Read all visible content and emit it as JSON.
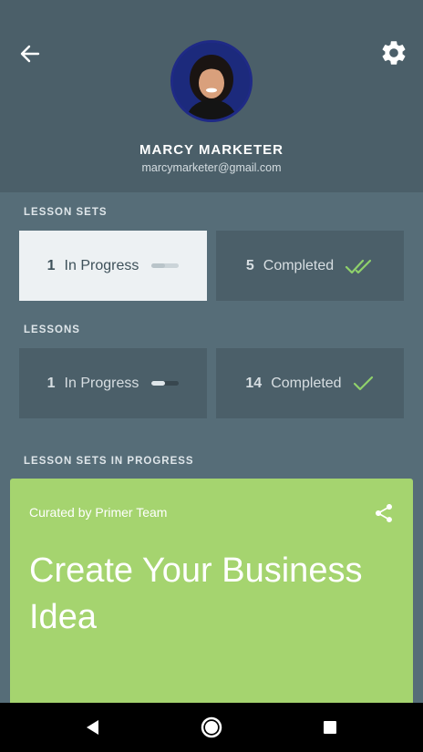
{
  "profile": {
    "name": "MARCY MARKETER",
    "email": "marcymarketer@gmail.com"
  },
  "icons": {
    "back": "arrow-left-icon",
    "settings": "gear-icon",
    "share": "share-icon",
    "completed_sets": "double-check-icon",
    "completed_lessons": "check-icon",
    "nav_back": "triangle-back-icon",
    "nav_home": "circle-home-icon",
    "nav_recents": "square-recents-icon"
  },
  "lesson_sets": {
    "label": "LESSON SETS",
    "in_progress": {
      "count": "1",
      "label": "In Progress",
      "progress": 0.5
    },
    "completed": {
      "count": "5",
      "label": "Completed"
    }
  },
  "lessons": {
    "label": "LESSONS",
    "in_progress": {
      "count": "1",
      "label": "In Progress",
      "progress": 0.5
    },
    "completed": {
      "count": "14",
      "label": "Completed"
    }
  },
  "in_progress_section": {
    "label": "LESSON SETS IN PROGRESS",
    "card": {
      "curator": "Curated by Primer Team",
      "title": "Create Your Business Idea"
    }
  },
  "colors": {
    "header_bg": "#4b5f69",
    "body_bg": "#566d78",
    "card_bg": "#a5d46f",
    "check_green": "#8fd16b",
    "active_card": "#edf1f3"
  }
}
